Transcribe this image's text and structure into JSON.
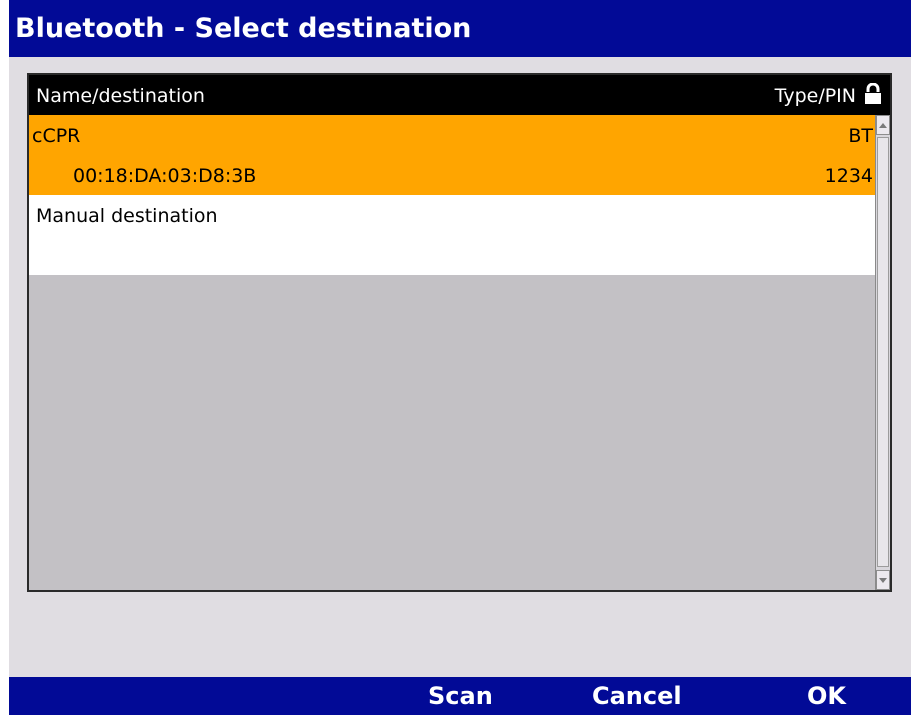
{
  "window": {
    "title": "Bluetooth - Select destination"
  },
  "list": {
    "columns": {
      "name": "Name/destination",
      "type": "Type/PIN",
      "lock_icon": "lock-icon"
    },
    "selected_row": {
      "name": "cCPR",
      "type": "BT",
      "address": "00:18:DA:03:D8:3B",
      "pin": "1234"
    },
    "manual_row": {
      "name": "Manual destination"
    }
  },
  "footer": {
    "scan": "Scan",
    "cancel": "Cancel",
    "ok": "OK"
  },
  "colors": {
    "title_bar": "#020a96",
    "selection": "#ffa500",
    "background": "#e0dde2",
    "list_empty": "#c3c1c5"
  }
}
